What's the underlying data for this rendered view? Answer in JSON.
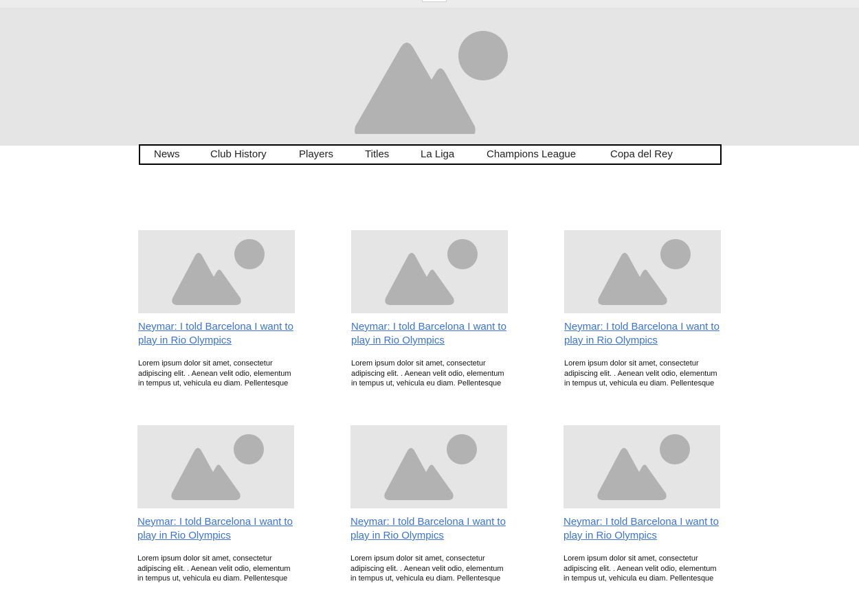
{
  "nav": {
    "items": [
      {
        "label": "News"
      },
      {
        "label": "Club History"
      },
      {
        "label": "Players"
      },
      {
        "label": "Titles"
      },
      {
        "label": "La Liga"
      },
      {
        "label": "Champions League"
      },
      {
        "label": "Copa del Rey"
      }
    ]
  },
  "articles": [
    {
      "title": "Neymar: I told Barcelona I want to play in Rio Olympics",
      "body": "Lorem ipsum dolor sit amet, consectetur adipiscing elit. . Aenean velit odio, elementum in tempus ut, vehicula eu diam. Pellentesque"
    },
    {
      "title": "Neymar: I told Barcelona I want to play in Rio Olympics",
      "body": "Lorem ipsum dolor sit amet, consectetur adipiscing elit. . Aenean velit odio, elementum in tempus ut, vehicula eu diam. Pellentesque"
    },
    {
      "title": "Neymar: I told Barcelona I want to play in Rio Olympics",
      "body": "Lorem ipsum dolor sit amet, consectetur adipiscing elit. . Aenean velit odio, elementum in tempus ut, vehicula eu diam. Pellentesque"
    },
    {
      "title": "Neymar: I told Barcelona I want to play in Rio Olympics",
      "body": "Lorem ipsum dolor sit amet, consectetur adipiscing elit. . Aenean velit odio, elementum in tempus ut, vehicula eu diam. Pellentesque"
    },
    {
      "title": "Neymar: I told Barcelona I want to play in Rio Olympics",
      "body": "Lorem ipsum dolor sit amet, consectetur adipiscing elit. . Aenean velit odio, elementum in tempus ut, vehicula eu diam. Pellentesque"
    },
    {
      "title": "Neymar: I told Barcelona I want to play in Rio Olympics",
      "body": "Lorem ipsum dolor sit amet, consectetur adipiscing elit. . Aenean velit odio, elementum in tempus ut, vehicula eu diam. Pellentesque"
    }
  ],
  "icons": {
    "hero": "image-placeholder-icon",
    "thumb": "image-placeholder-icon"
  },
  "colors": {
    "placeholder_bg": "#e5e5e5",
    "placeholder_shape": "#b2b2b2",
    "link": "#3b74d6",
    "nav_border": "#000000"
  }
}
